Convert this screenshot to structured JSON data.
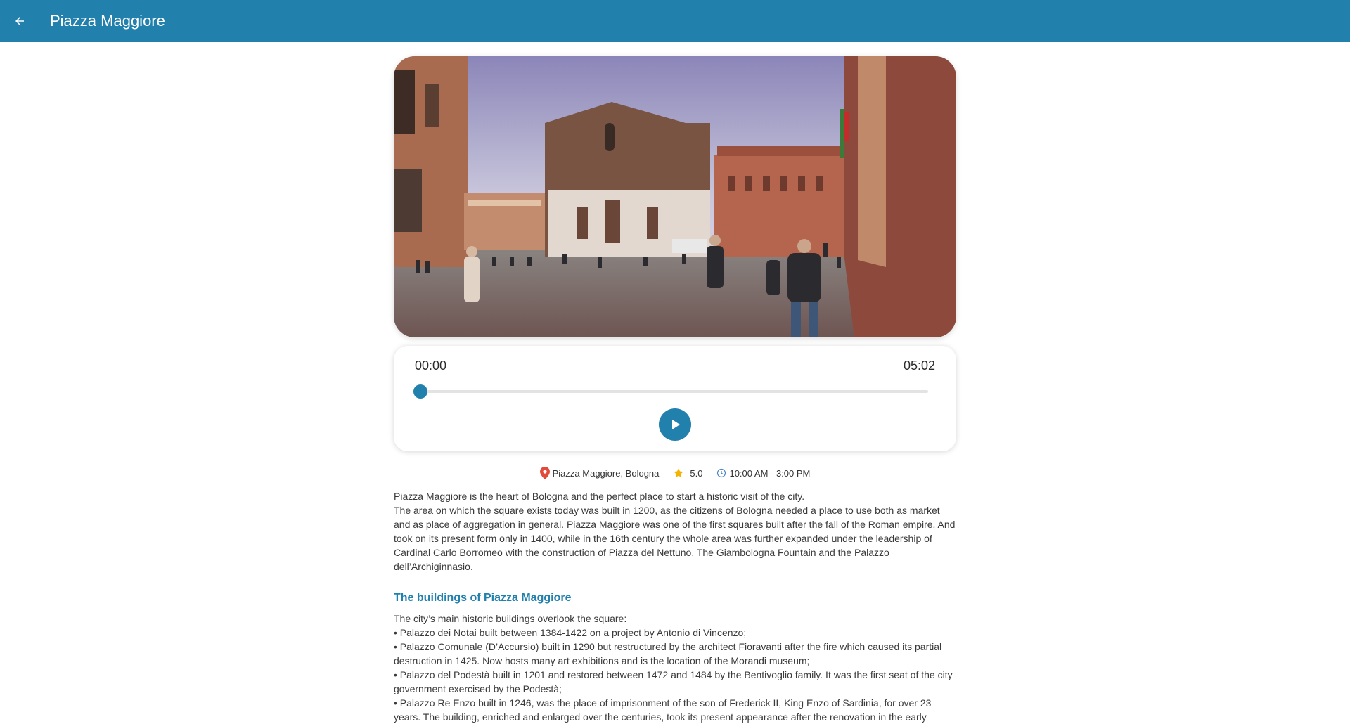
{
  "appbar": {
    "title": "Piazza Maggiore",
    "back_icon": "arrow-back-icon",
    "color": "#2280ad"
  },
  "hero": {
    "image": "piazza-maggiore-photo"
  },
  "player": {
    "current_time": "00:00",
    "total_time": "05:02",
    "progress": 0,
    "play_icon": "play-icon"
  },
  "info": {
    "location": "Piazza Maggiore, Bologna",
    "location_icon": "map-pin-icon",
    "rating": "5.0",
    "rating_icon": "star-icon",
    "hours": "10:00 AM - 3:00 PM",
    "hours_icon": "clock-icon"
  },
  "description": {
    "line1": "Piazza Maggiore is the heart of Bologna and the perfect place to start a historic visit of the city.",
    "line2": "The area on which the square exists today was built in 1200, as the citizens of Bologna needed a place to use both as market and as place of aggregation in general. Piazza Maggiore was one of the first squares built after the fall of the Roman empire. And took on its present form only in 1400, while in the 16th century the whole area was further expanded under the leadership of Cardinal Carlo Borromeo with the construction of Piazza del Nettuno, The Giambologna Fountain and the Palazzo dell’Archiginnasio."
  },
  "buildings": {
    "title": "The buildings of Piazza Maggiore",
    "intro": "The city’s main historic buildings overlook the square:",
    "items": [
      "• Palazzo dei Notai built between 1384-1422 on a project by Antonio di Vincenzo;",
      "• Palazzo Comunale (D’Accursio) built in 1290 but restructured by the architect Fioravanti after the fire which caused its partial destruction in 1425. Now hosts many art exhibitions and is the location of the Morandi museum;",
      "• Palazzo del Podestà built in 1201 and restored between 1472 and 1484 by the Bentivoglio family. It was the first seat of the city government exercised by the Podestà;",
      "• Palazzo Re Enzo built in 1246, was the place of imprisonment of the son of Frederick II, King Enzo of Sardinia, for over 23 years. The building, enriched and enlarged over the centuries, took its present appearance after the renovation in the early"
    ]
  }
}
